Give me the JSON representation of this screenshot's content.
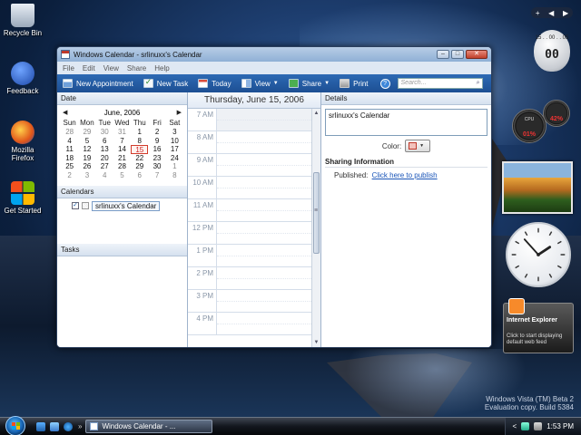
{
  "desktop": {
    "icons": [
      {
        "label": "Recycle Bin"
      },
      {
        "label": "Feedback"
      },
      {
        "label": "Mozilla Firefox"
      },
      {
        "label": "Get Started"
      }
    ],
    "watermark_line1": "Windows Vista (TM) Beta 2",
    "watermark_line2": "Evaluation copy. Build 5384"
  },
  "window": {
    "title": "Windows Calendar - srlinuxx's Calendar",
    "menu": [
      "File",
      "Edit",
      "View",
      "Share",
      "Help"
    ],
    "toolbar": {
      "new_appointment": "New Appointment",
      "new_task": "New Task",
      "today": "Today",
      "view": "View",
      "share": "Share",
      "print": "Print",
      "help": "?",
      "search_placeholder": "Search..."
    }
  },
  "left_pane": {
    "date_header": "Date",
    "month_label": "June, 2006",
    "prev_arrow": "◀",
    "next_arrow": "▶",
    "weekdays": [
      "Sun",
      "Mon",
      "Tue",
      "Wed",
      "Thu",
      "Fri",
      "Sat"
    ],
    "weeks": [
      [
        "28",
        "29",
        "30",
        "31",
        "1",
        "2",
        "3"
      ],
      [
        "4",
        "5",
        "6",
        "7",
        "8",
        "9",
        "10"
      ],
      [
        "11",
        "12",
        "13",
        "14",
        "15",
        "16",
        "17"
      ],
      [
        "18",
        "19",
        "20",
        "21",
        "22",
        "23",
        "24"
      ],
      [
        "25",
        "26",
        "27",
        "28",
        "29",
        "30",
        "1"
      ],
      [
        "2",
        "3",
        "4",
        "5",
        "6",
        "7",
        "8"
      ]
    ],
    "today_day": "15",
    "calendars_header": "Calendars",
    "calendar_name": "srlinuxx's Calendar",
    "calendar_checked": true,
    "tasks_header": "Tasks"
  },
  "day_view": {
    "heading": "Thursday, June 15, 2006",
    "hours": [
      "7 AM",
      "8 AM",
      "9 AM",
      "10 AM",
      "11 AM",
      "12 PM",
      "1 PM",
      "2 PM",
      "3 PM",
      "4 PM"
    ]
  },
  "details": {
    "header": "Details",
    "calendar_name": "srlinuxx's Calendar",
    "color_label": "Color:",
    "sharing_title": "Sharing Information",
    "published_label": "Published:",
    "publish_link": "Click here to publish"
  },
  "gadgets": {
    "sidebar_controls": [
      "+",
      "◀",
      "▶"
    ],
    "timer_small": "15 . . 00 . . 05",
    "timer_big": "00",
    "cpu_label": "CPU",
    "cpu_value": "01%",
    "ram_value": "42%",
    "feed_title": "Internet Explorer",
    "feed_text": "Click to start displaying default web feed",
    "clock_hour": 1,
    "clock_minute": 53
  },
  "taskbar": {
    "task_button": "Windows Calendar - ...",
    "tray_arrow": "<",
    "time": "1:53 PM"
  }
}
